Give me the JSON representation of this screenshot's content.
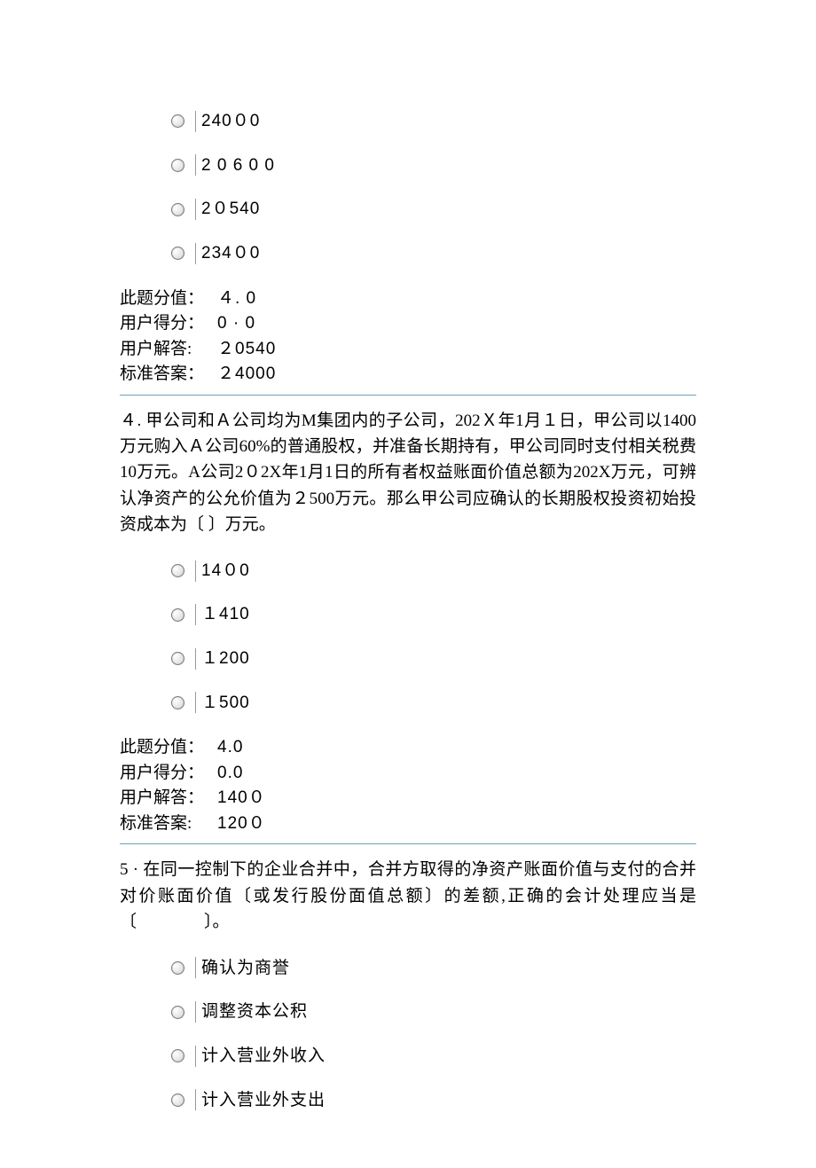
{
  "q3": {
    "options": [
      "240０0",
      "2 0 6 0 0",
      "2０540",
      "234０0"
    ],
    "score": {
      "points_label": "此题分值：",
      "points_value": "４. 0",
      "user_score_label": "用户得分：",
      "user_score_value": "0 · 0",
      "user_answer_label": "用户解答:",
      "user_answer_value": "２0540",
      "correct_label": "标准答案：",
      "correct_value": "２4000"
    }
  },
  "q4": {
    "text": "４. 甲公司和Ａ公司均为M集团内的子公司，202Ｘ年1月１日，甲公司以1400万元购入Ａ公司60%的普通股权，并准备长期持有，甲公司同时支付相关税费10万元。A公司2０2X年1月1日的所有者权益账面价值总额为202X万元，可辨认净资产的公允价值为２500万元。那么甲公司应确认的长期股权投资初始投资成本为〔  〕万元。",
    "options": [
      "14０0",
      "１410",
      "１200",
      "１500"
    ],
    "score": {
      "points_label": "此题分值：",
      "points_value": "4.0",
      "user_score_label": "用户得分：",
      "user_score_value": "0.0",
      "user_answer_label": "用户解答：",
      "user_answer_value": "140０",
      "correct_label": "标准答案:",
      "correct_value": "120０"
    }
  },
  "q5": {
    "text": "5 · 在同一控制下的企业合并中，合并方取得的净资产账面价值与支付的合并对价账面价值〔或发行股份面值总额〕的差额,正确的会计处理应当是〔　　　　〕。",
    "options": [
      "确认为商誉",
      "调整资本公积",
      "计入营业外收入",
      "计入营业外支出"
    ]
  }
}
